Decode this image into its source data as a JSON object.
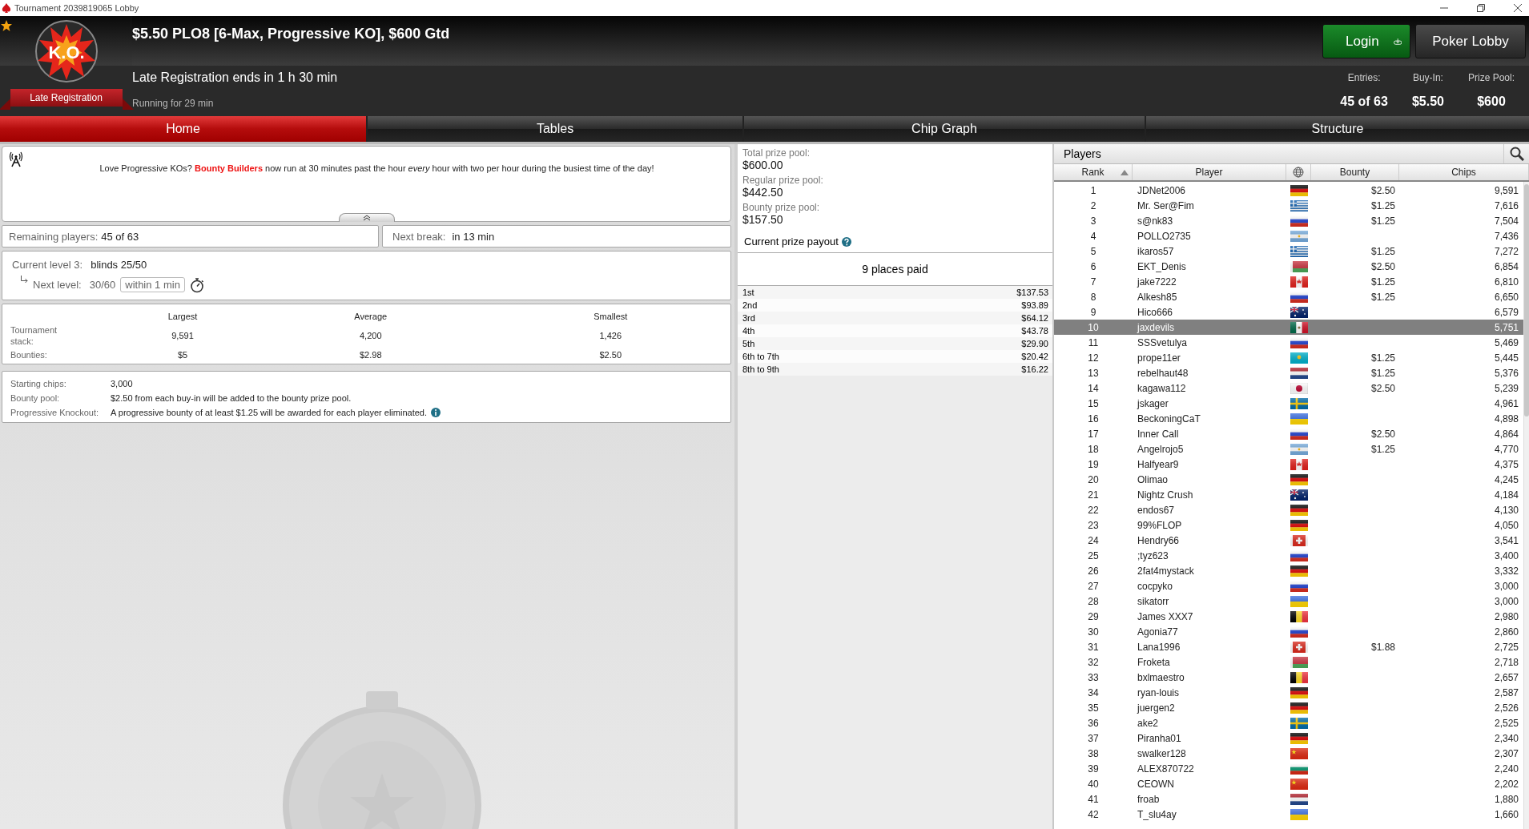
{
  "window": {
    "title": "Tournament 2039819065 Lobby"
  },
  "header": {
    "logo_text": "K.O.",
    "badge": "Late Registration",
    "title": "$5.50 PLO8 [6-Max, Progressive KO], $600 Gtd",
    "late_registration": "Late Registration ends in 1 h 30 min",
    "running": "Running for 29 min",
    "buttons": [
      {
        "label": "Login",
        "kind": "login"
      },
      {
        "label": "Poker Lobby",
        "kind": "plain"
      }
    ],
    "stats": [
      {
        "label": "Entries:",
        "value": "45 of 63"
      },
      {
        "label": "Buy-In:",
        "value": "$5.50"
      },
      {
        "label": "Prize Pool:",
        "value": "$600"
      }
    ]
  },
  "tabs": [
    {
      "label": "Home",
      "selected": true
    },
    {
      "label": "Tables",
      "selected": false
    },
    {
      "label": "Chip Graph",
      "selected": false
    },
    {
      "label": "Structure",
      "selected": false
    }
  ],
  "news": {
    "text": "Love Progressive KOs? **Bounty Builders** now run at 30 minutes past the hour *every* hour with two per hour during the busiest time of the day!"
  },
  "remaining": {
    "label": "Remaining players:",
    "value": "45 of 63"
  },
  "next_break": {
    "label": "Next break:",
    "value": "in 13 min"
  },
  "level": {
    "label": "Current level 3:",
    "value": "blinds 25/50",
    "next_label": "Next level:",
    "next_value": "30/60",
    "next_time": "within 1 min"
  },
  "stack_stats": {
    "columns": [
      "Largest",
      "Average",
      "Smallest"
    ],
    "rows": [
      {
        "label": "Tournament stack:",
        "values": [
          "9,591",
          "4,200",
          "1,426"
        ]
      },
      {
        "label": "Bounties:",
        "values": [
          "$5",
          "$2.98",
          "$2.50"
        ]
      }
    ]
  },
  "details": [
    {
      "label": "Starting chips:",
      "value": "3,000",
      "info": false
    },
    {
      "label": "Bounty pool:",
      "value": "$2.50 from each buy-in will be added to the bounty prize pool.",
      "info": false
    },
    {
      "label": "Progressive Knockout:",
      "value": "A progressive bounty of at least $1.25 will be awarded for each player eliminated.",
      "info": true
    }
  ],
  "prize": {
    "pools": [
      {
        "label": "Total prize pool:",
        "value": "$600.00"
      },
      {
        "label": "Regular prize pool:",
        "value": "$442.50"
      },
      {
        "label": "Bounty prize pool:",
        "value": "$157.50"
      }
    ],
    "payout_title": "Current prize payout",
    "places_paid": "9 places paid",
    "payouts": [
      {
        "place": "1st",
        "amount": "$137.53"
      },
      {
        "place": "2nd",
        "amount": "$93.89"
      },
      {
        "place": "3rd",
        "amount": "$64.12"
      },
      {
        "place": "4th",
        "amount": "$43.78"
      },
      {
        "place": "5th",
        "amount": "$29.90"
      },
      {
        "place": "6th to 7th",
        "amount": "$20.42"
      },
      {
        "place": "8th to 9th",
        "amount": "$16.22"
      }
    ]
  },
  "players": {
    "title": "Players",
    "columns": [
      {
        "kind": "text",
        "label": "Rank",
        "sorted": true
      },
      {
        "kind": "text",
        "label": "Player",
        "sorted": false
      },
      {
        "kind": "globe",
        "sorted": false
      },
      {
        "kind": "text",
        "label": "Bounty",
        "sorted": false
      },
      {
        "kind": "text",
        "label": "Chips",
        "sorted": false
      }
    ],
    "rows": [
      {
        "rank": "1",
        "player": "JDNet2006",
        "kind": "de",
        "bounty": "$2.50",
        "chips": "9,591",
        "selected": false
      },
      {
        "rank": "2",
        "player": "Mr. Ser@Fim",
        "kind": "gr",
        "bounty": "$1.25",
        "chips": "7,616",
        "selected": false
      },
      {
        "rank": "3",
        "player": "s@nk83",
        "kind": "ru",
        "bounty": "$1.25",
        "chips": "7,504",
        "selected": false
      },
      {
        "rank": "4",
        "player": "POLLO2735",
        "kind": "ar",
        "chips": "7,436",
        "selected": false
      },
      {
        "rank": "5",
        "player": "ikaros57",
        "kind": "gr",
        "bounty": "$1.25",
        "chips": "7,272",
        "selected": false
      },
      {
        "rank": "6",
        "player": "EKT_Denis",
        "kind": "by",
        "bounty": "$2.50",
        "chips": "6,854",
        "selected": false
      },
      {
        "rank": "7",
        "player": "jake7222",
        "kind": "ca",
        "bounty": "$1.25",
        "chips": "6,810",
        "selected": false
      },
      {
        "rank": "8",
        "player": "Alkesh85",
        "kind": "ru",
        "bounty": "$1.25",
        "chips": "6,650",
        "selected": false
      },
      {
        "rank": "9",
        "player": "Hico666",
        "kind": "au",
        "chips": "6,579",
        "selected": false
      },
      {
        "rank": "10",
        "player": "jaxdevils",
        "kind": "mx",
        "chips": "5,751",
        "selected": true
      },
      {
        "rank": "11",
        "player": "SSSvetulya",
        "kind": "ru",
        "chips": "5,469",
        "selected": false
      },
      {
        "rank": "12",
        "player": "prope11er",
        "kind": "kz",
        "bounty": "$1.25",
        "chips": "5,445",
        "selected": false
      },
      {
        "rank": "13",
        "player": "rebelhaut48",
        "kind": "nl",
        "bounty": "$1.25",
        "chips": "5,376",
        "selected": false
      },
      {
        "rank": "14",
        "player": "kagawa112",
        "kind": "jp",
        "bounty": "$2.50",
        "chips": "5,239",
        "selected": false
      },
      {
        "rank": "15",
        "player": "jskager",
        "kind": "se",
        "chips": "4,961",
        "selected": false
      },
      {
        "rank": "16",
        "player": "BeckoningCaT",
        "kind": "ua",
        "chips": "4,898",
        "selected": false
      },
      {
        "rank": "17",
        "player": "Inner Call",
        "kind": "ru",
        "bounty": "$2.50",
        "chips": "4,864",
        "selected": false
      },
      {
        "rank": "18",
        "player": "Angelrojo5",
        "kind": "ar",
        "bounty": "$1.25",
        "chips": "4,770",
        "selected": false
      },
      {
        "rank": "19",
        "player": "Halfyear9",
        "kind": "ca",
        "chips": "4,375",
        "selected": false
      },
      {
        "rank": "20",
        "player": "Olimao",
        "kind": "de",
        "chips": "4,245",
        "selected": false
      },
      {
        "rank": "21",
        "player": "Nightz Crush",
        "kind": "au",
        "chips": "4,184",
        "selected": false
      },
      {
        "rank": "22",
        "player": "endos67",
        "kind": "de",
        "chips": "4,130",
        "selected": false
      },
      {
        "rank": "23",
        "player": "99%FLOP",
        "kind": "de",
        "chips": "4,050",
        "selected": false
      },
      {
        "rank": "24",
        "player": "Hendry66",
        "kind": "ch",
        "chips": "3,541",
        "selected": false
      },
      {
        "rank": "25",
        "player": ";tyz623",
        "kind": "ru",
        "chips": "3,400",
        "selected": false
      },
      {
        "rank": "26",
        "player": "2fat4mystack",
        "kind": "de",
        "chips": "3,332",
        "selected": false
      },
      {
        "rank": "27",
        "player": "cocpyko",
        "kind": "ru",
        "chips": "3,000",
        "selected": false
      },
      {
        "rank": "28",
        "player": "sikatorr",
        "kind": "ua",
        "chips": "3,000",
        "selected": false
      },
      {
        "rank": "29",
        "player": "James XXX7",
        "kind": "be",
        "chips": "2,980",
        "selected": false
      },
      {
        "rank": "30",
        "player": "Agonia77",
        "kind": "ru",
        "chips": "2,860",
        "selected": false
      },
      {
        "rank": "31",
        "player": "Lana1996",
        "kind": "ch",
        "bounty": "$1.88",
        "chips": "2,725",
        "selected": false
      },
      {
        "rank": "32",
        "player": "Froketa",
        "kind": "by",
        "chips": "2,718",
        "selected": false
      },
      {
        "rank": "33",
        "player": "bxlmaestro",
        "kind": "be",
        "chips": "2,657",
        "selected": false
      },
      {
        "rank": "34",
        "player": "ryan-louis",
        "kind": "de",
        "chips": "2,587",
        "selected": false
      },
      {
        "rank": "35",
        "player": "juergen2",
        "kind": "de",
        "chips": "2,526",
        "selected": false
      },
      {
        "rank": "36",
        "player": "ake2",
        "kind": "se",
        "chips": "2,525",
        "selected": false
      },
      {
        "rank": "37",
        "player": "Piranha01",
        "kind": "de",
        "chips": "2,340",
        "selected": false
      },
      {
        "rank": "38",
        "player": "swalker128",
        "kind": "cn",
        "chips": "2,307",
        "selected": false
      },
      {
        "rank": "39",
        "player": "ALEX870722",
        "kind": "bg",
        "chips": "2,240",
        "selected": false
      },
      {
        "rank": "40",
        "player": "CEOWN",
        "kind": "cn",
        "chips": "2,202",
        "selected": false
      },
      {
        "rank": "41",
        "player": "froab",
        "kind": "nl",
        "chips": "1,880",
        "selected": false
      },
      {
        "rank": "42",
        "player": "T_slu4ay",
        "kind": "ua",
        "chips": "1,660",
        "selected": false
      }
    ]
  }
}
